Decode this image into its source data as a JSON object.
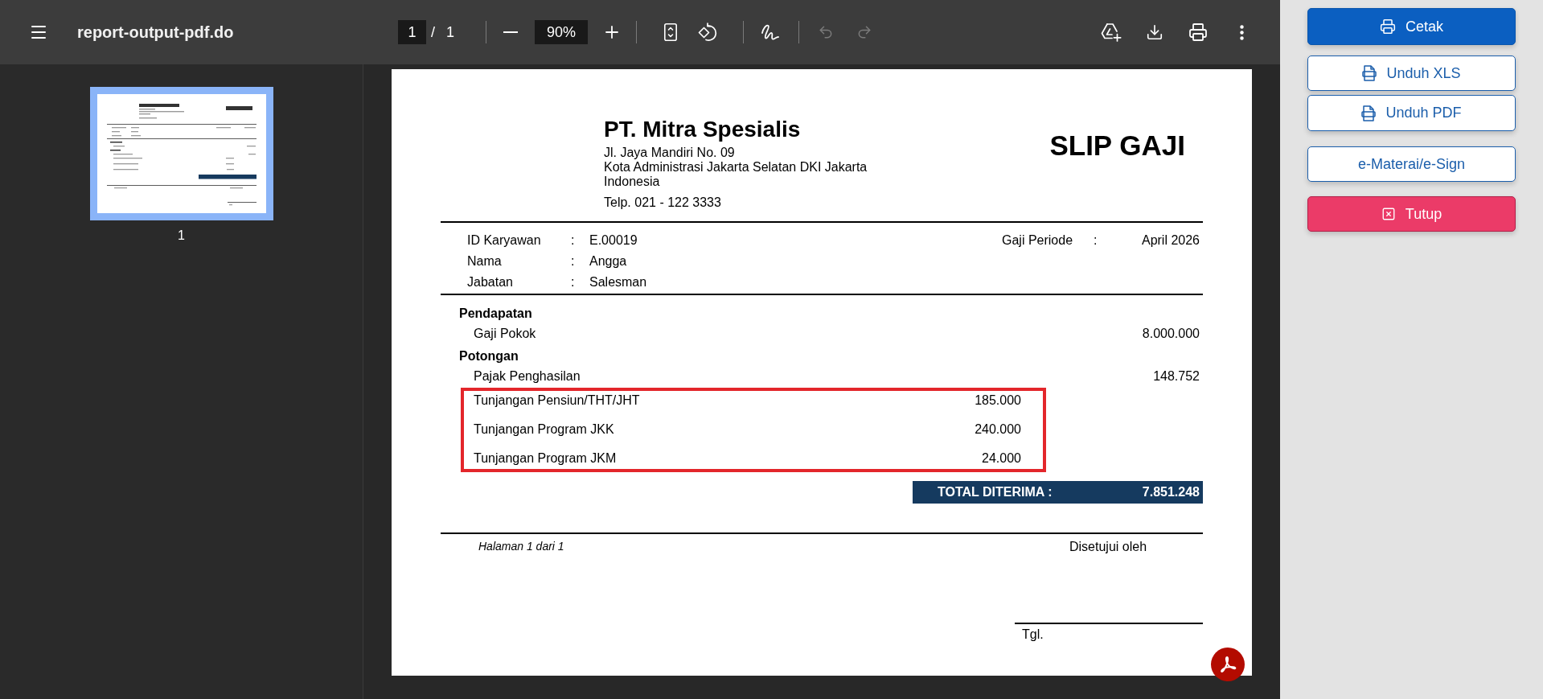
{
  "viewer": {
    "toolbar": {
      "title": "report-output-pdf.do",
      "page_current": "1",
      "page_separator": "/",
      "page_total": "1",
      "zoom": "90%",
      "undo": {
        "disabled": true
      },
      "redo": {
        "disabled": true
      }
    },
    "thumbnails": [
      {
        "label": "1",
        "selected": true
      }
    ],
    "document": {
      "company": {
        "name": "PT. Mitra Spesialis",
        "address_lines": [
          "Jl. Jaya Mandiri No. 09",
          "Kota Administrasi Jakarta Selatan DKI Jakarta",
          "Indonesia"
        ],
        "phone": "Telp. 021 - 122 3333"
      },
      "title": "SLIP GAJI",
      "employee_fields": [
        {
          "label": "ID Karyawan",
          "separator": ":",
          "value": "E.00019"
        },
        {
          "label": "Nama",
          "separator": ":",
          "value": "Angga"
        },
        {
          "label": "Jabatan",
          "separator": ":",
          "value": "Salesman"
        }
      ],
      "period": {
        "label": "Gaji Periode",
        "separator": ":",
        "value": "April 2026"
      },
      "sections": [
        {
          "heading": "Pendapatan",
          "items": [
            {
              "label": "Gaji Pokok",
              "amount": "8.000.000"
            }
          ]
        },
        {
          "heading": "Potongan",
          "items": [
            {
              "label": "Pajak Penghasilan",
              "amount": "148.752"
            }
          ],
          "marked_items": [
            {
              "label": "Tunjangan Pensiun/THT/JHT",
              "amount": "185.000"
            },
            {
              "label": "Tunjangan Program JKK",
              "amount": "240.000"
            },
            {
              "label": "Tunjangan Program JKM",
              "amount": "24.000"
            }
          ]
        }
      ],
      "total": {
        "label": "TOTAL DITERIMA :",
        "value": "7.851.248"
      },
      "footer": {
        "page_note": "Halaman 1 dari 1",
        "approval": "Disetujui oleh",
        "date_label": "Tgl."
      }
    }
  },
  "actions": [
    {
      "label": "Cetak",
      "kind": "print"
    },
    {
      "label": "Unduh XLS",
      "kind": "xls"
    },
    {
      "label": "Unduh PDF",
      "kind": "pdf"
    },
    {
      "label": "e-Materai/e-Sign",
      "kind": "sign"
    },
    {
      "label": "Tutup",
      "kind": "close"
    }
  ]
}
